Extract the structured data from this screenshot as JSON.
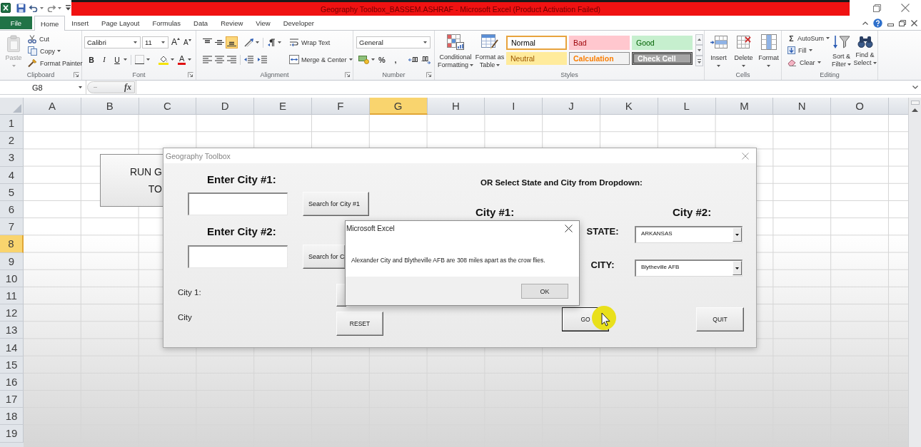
{
  "title_bar": {
    "title": "Geography Toolbox_BASSEM.ASHRAF - Microsoft Excel (Product Activation Failed)"
  },
  "ribbon_tabs": [
    {
      "label": "File",
      "kind": "file",
      "selected": false
    },
    {
      "label": "Home",
      "kind": "tab",
      "selected": true
    },
    {
      "label": "Insert",
      "kind": "tab",
      "selected": false
    },
    {
      "label": "Page Layout",
      "kind": "tab",
      "selected": false
    },
    {
      "label": "Formulas",
      "kind": "tab",
      "selected": false
    },
    {
      "label": "Data",
      "kind": "tab",
      "selected": false
    },
    {
      "label": "Review",
      "kind": "tab",
      "selected": false
    },
    {
      "label": "View",
      "kind": "tab",
      "selected": false
    },
    {
      "label": "Developer",
      "kind": "tab",
      "selected": false
    }
  ],
  "ribbon_groups": [
    {
      "kind": "clipboard",
      "label": "Clipboard",
      "paste": {
        "label": "Paste",
        "disabled": true
      },
      "commands": [
        {
          "label": "Cut",
          "dropdown": false
        },
        {
          "label": "Copy",
          "dropdown": true
        },
        {
          "label": "Format Painter",
          "dropdown": false
        }
      ]
    },
    {
      "kind": "font",
      "label": "Font",
      "font_name": "Calibri",
      "font_size": "11",
      "size_buttons": [
        "A",
        "A"
      ],
      "style_buttons": [
        "B",
        "I",
        "U"
      ],
      "font_color_button": "A"
    },
    {
      "kind": "alignment",
      "label": "Alignment",
      "vertical_alignment": [
        {
          "selected": false
        },
        {
          "selected": false
        },
        {
          "selected": true
        }
      ],
      "wrap_text": "Wrap Text",
      "merge_center": "Merge & Center"
    },
    {
      "kind": "number",
      "label": "Number",
      "number_format": "General",
      "symbol_buttons": [
        "%",
        ","
      ]
    },
    {
      "kind": "styles",
      "label": "Styles",
      "commands": [
        {
          "label": "Conditional\nFormatting"
        },
        {
          "label": "Format as\nTable"
        }
      ],
      "cell_styles": [
        {
          "label": "Normal",
          "kind": "normal",
          "color": "#ffffff",
          "selected": true
        },
        {
          "label": "Bad",
          "kind": "bad",
          "color": "#ffc7ce",
          "selected": false
        },
        {
          "label": "Good",
          "kind": "good",
          "color": "#c6efce",
          "selected": false
        },
        {
          "label": "Neutral",
          "kind": "neutral",
          "color": "#ffeb9c",
          "selected": false
        },
        {
          "label": "Calculation",
          "kind": "calculation",
          "color": "#f2f2f2",
          "selected": false
        },
        {
          "label": "Check Cell",
          "kind": "check",
          "color": "#a5a5a5",
          "selected": false
        }
      ]
    },
    {
      "kind": "cells",
      "label": "Cells",
      "commands": [
        {
          "label": "Insert"
        },
        {
          "label": "Delete"
        },
        {
          "label": "Format"
        }
      ]
    },
    {
      "kind": "editing",
      "label": "Editing",
      "list_commands": [
        {
          "label": "AutoSum",
          "symbol": "Σ"
        },
        {
          "label": "Fill"
        },
        {
          "label": "Clear"
        }
      ],
      "commands": [
        {
          "label": "Sort &\nFilter"
        },
        {
          "label": "Find &\nSelect"
        }
      ]
    }
  ],
  "formula_bar": {
    "name_box": "G8",
    "function_button": "fx"
  },
  "sheet": {
    "columns": [
      {
        "label": "A",
        "selected": false
      },
      {
        "label": "B",
        "selected": false
      },
      {
        "label": "C",
        "selected": false
      },
      {
        "label": "D",
        "selected": false
      },
      {
        "label": "E",
        "selected": false
      },
      {
        "label": "F",
        "selected": false
      },
      {
        "label": "G",
        "selected": true
      },
      {
        "label": "H",
        "selected": false
      },
      {
        "label": "I",
        "selected": false
      },
      {
        "label": "J",
        "selected": false
      },
      {
        "label": "K",
        "selected": false
      },
      {
        "label": "L",
        "selected": false
      },
      {
        "label": "M",
        "selected": false
      },
      {
        "label": "N",
        "selected": false
      },
      {
        "label": "O",
        "selected": false
      }
    ],
    "rows": [
      {
        "label": "1",
        "selected": false
      },
      {
        "label": "2",
        "selected": false
      },
      {
        "label": "3",
        "selected": false
      },
      {
        "label": "4",
        "selected": false
      },
      {
        "label": "5",
        "selected": false
      },
      {
        "label": "6",
        "selected": false
      },
      {
        "label": "7",
        "selected": false
      },
      {
        "label": "8",
        "selected": true
      },
      {
        "label": "9",
        "selected": false
      },
      {
        "label": "10",
        "selected": false
      },
      {
        "label": "11",
        "selected": false
      },
      {
        "label": "12",
        "selected": false
      },
      {
        "label": "13",
        "selected": false
      },
      {
        "label": "14",
        "selected": false
      },
      {
        "label": "15",
        "selected": false
      },
      {
        "label": "16",
        "selected": false
      },
      {
        "label": "17",
        "selected": false
      },
      {
        "label": "18",
        "selected": false
      },
      {
        "label": "19",
        "selected": false
      }
    ]
  },
  "sheet_shape": {
    "text": "RUN G\nTO"
  },
  "geography_dialog": {
    "title": "Geography Toolbox",
    "city_entries": [
      {
        "heading": "Enter City #1:",
        "search_button": "Search for City #1"
      },
      {
        "heading": "Enter City #2:",
        "search_button": "Search for C"
      }
    ],
    "result_labels": [
      "City 1:",
      "City"
    ],
    "dropdown_heading": "OR Select State and City from Dropdown:",
    "city_headings": [
      "City #1:",
      "City #2:"
    ],
    "selectors": [
      {
        "label": "STATE:",
        "value": "ARKANSAS"
      },
      {
        "label": "CITY:",
        "value": "Blytheville AFB"
      }
    ],
    "buttons": [
      {
        "label": "RESET",
        "focused": false
      },
      {
        "label": "GO",
        "focused": true
      },
      {
        "label": "QUIT",
        "focused": false
      }
    ]
  },
  "message_box": {
    "title": "Microsoft Excel",
    "message": "Alexander City and Blytheville AFB are 308 miles apart as the crow flies.",
    "button": "OK"
  }
}
